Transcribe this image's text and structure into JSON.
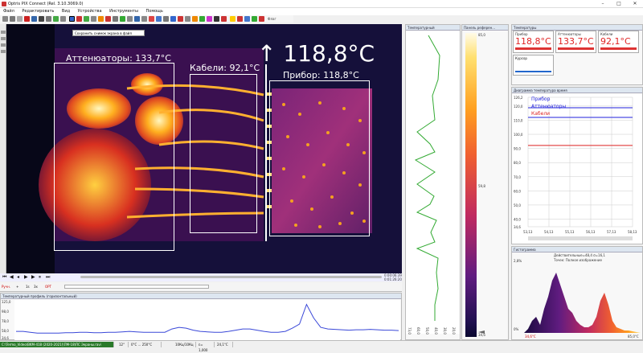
{
  "window": {
    "title": "Optris PIX Connect (Rel. 3.10.3069.0)"
  },
  "menu": [
    "Файл",
    "Редактировать",
    "Вид",
    "Устройства",
    "Инструменты",
    "Помощь"
  ],
  "toolbar": {
    "flag_label": "Флаг",
    "tooltip": "Сохранить снимок экрана в файл"
  },
  "thermal": {
    "big_temp": "↑ 118,8°C",
    "labels": {
      "attenuators": "Аттенюаторы: 133,7°C",
      "cables": "Кабели: 92,1°C",
      "device": "Прибор: 118,8°C"
    }
  },
  "player": {
    "time_top": "0:00:06:39",
    "time_bottom": "0:01:26:20",
    "manual": "Ручн.",
    "btn_1s": "1s",
    "btn_3x": "3x",
    "opt": "OPT"
  },
  "temp_profile": {
    "title": "Температурный профиль (горизонтальный)",
    "yticks": [
      "125,0",
      "98,0",
      "78,0",
      "58,0",
      "34,6"
    ]
  },
  "vertical_profile": {
    "title": "Температурный",
    "xticks": [
      "73,0",
      "60,0",
      "50,0",
      "40,0",
      "30,0",
      "20,0"
    ]
  },
  "colorbar": {
    "title": "Панель референ...",
    "top": "85,0",
    "mid": "59,8",
    "bottom": "34,6"
  },
  "temperatures": {
    "title": "Температуры",
    "cards": [
      {
        "name": "Прибор",
        "value": "118,8°C"
      },
      {
        "name": "Аттенюаторы",
        "value": "133,7°C"
      },
      {
        "name": "Кабели",
        "value": "92,1°C"
      }
    ],
    "cursor_label": "Курсор"
  },
  "time_chart": {
    "title": "Диаграмма температура время",
    "yticks": [
      "126,2",
      "120,0",
      "110,0",
      "100,0",
      "90,0",
      "80,0",
      "70,0",
      "60,0",
      "50,0",
      "40,0",
      "34,6"
    ],
    "xticks": [
      "53,13",
      "54,13",
      "55,13",
      "56,13",
      "57,13",
      "58,13"
    ],
    "legend": [
      "Прибор",
      "Аттенюаторы",
      "Кабели"
    ],
    "legend_colors": [
      "#2222dd",
      "#2222dd",
      "#dd2222"
    ]
  },
  "histogram": {
    "title": "Гистограмма",
    "info1": "Действительные=48,4 σ=16,1",
    "info2": "Точек: Полное изображение",
    "ymax": "2,8%",
    "ymid": "0%",
    "xmin": "34,6°C",
    "xmax": "85,0°C"
  },
  "status": {
    "path": "C:\\Termo_Video\\BKM-418 (2020-2021)\\ПМ-18\\ПС Экраны.ravi",
    "range_a": "12°",
    "range_b": "0°C ... 250°C",
    "fps": "10Кц/10Кц",
    "emiss": "ε= 1,000",
    "amb": "24,1°C"
  },
  "chart_data": [
    {
      "type": "line",
      "title": "Диаграмма температура время",
      "x": [
        "53,13",
        "54,13",
        "55,13",
        "56,13",
        "57,13",
        "58,13"
      ],
      "ylim": [
        34.6,
        126.2
      ],
      "series": [
        {
          "name": "Прибор",
          "values": [
            118.8,
            118.8,
            118.8,
            118.8,
            118.8,
            118.8
          ]
        },
        {
          "name": "Аттенюаторы",
          "values": [
            112.0,
            112.0,
            112.0,
            112.0,
            112.0,
            112.0
          ]
        },
        {
          "name": "Кабели",
          "values": [
            92.1,
            92.1,
            92.1,
            92.1,
            92.1,
            92.1
          ]
        }
      ]
    },
    {
      "type": "line",
      "title": "Температурный профиль (горизонтальный)",
      "ylim": [
        34.6,
        125.0
      ],
      "series": [
        {
          "name": "",
          "values": [
            52,
            52,
            50,
            48,
            48,
            48,
            48,
            49,
            49,
            50,
            50,
            49,
            49,
            50,
            50,
            51,
            52,
            51,
            50,
            50,
            50,
            50,
            58,
            62,
            60,
            55,
            52,
            51,
            50,
            50,
            52,
            55,
            58,
            58,
            55,
            52,
            50,
            50,
            52,
            60,
            70,
            118,
            85,
            62,
            58,
            57,
            56,
            55,
            56,
            56,
            57,
            56,
            55,
            55,
            54
          ]
        }
      ]
    }
  ]
}
